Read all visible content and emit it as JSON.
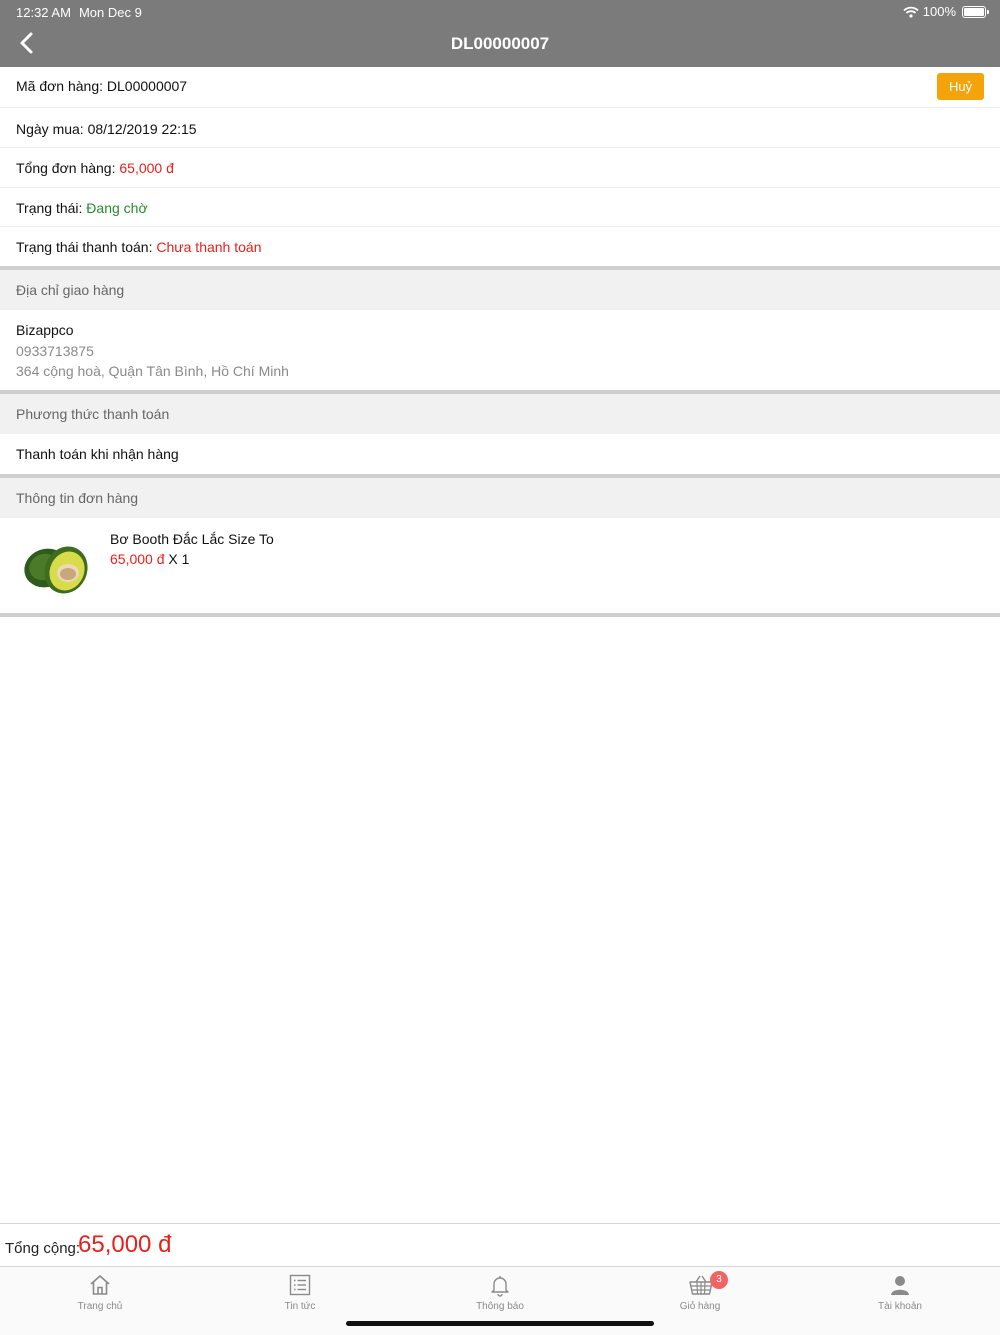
{
  "status": {
    "time": "12:32 AM",
    "date": "Mon Dec 9",
    "battery": "100%"
  },
  "nav": {
    "title": "DL00000007",
    "back_icon": "chevron-left-icon"
  },
  "order": {
    "code_label": "Mã đơn hàng:",
    "code_value": "DL00000007",
    "cancel_label": "Huỷ",
    "date_label": "Ngày mua:",
    "date_value": "08/12/2019 22:15",
    "total_label": "Tổng đơn hàng:",
    "total_value": "65,000 đ",
    "status_label": "Trạng thái:",
    "status_value": "Đang chờ",
    "payment_status_label": "Trạng thái thanh toán:",
    "payment_status_value": "Chưa thanh toán"
  },
  "shipping": {
    "heading": "Địa chỉ giao hàng",
    "name": "Bizappco",
    "phone": "0933713875",
    "address": "364 cộng hoà, Quận Tân Bình, Hồ Chí Minh"
  },
  "payment_method": {
    "heading": "Phương thức thanh toán",
    "value": "Thanh toán khi nhận hàng"
  },
  "order_info": {
    "heading": "Thông tin đơn hàng",
    "items": [
      {
        "name": "Bơ Booth Đắc Lắc Size To",
        "price": "65,000 đ",
        "qty": "X 1"
      }
    ]
  },
  "summary": {
    "total_label": "Tổng cộng:",
    "total_value": "65,000 đ"
  },
  "tabs": [
    {
      "label": "Trang chủ",
      "icon": "home-icon"
    },
    {
      "label": "Tin tức",
      "icon": "news-list-icon"
    },
    {
      "label": "Thông báo",
      "icon": "bell-icon"
    },
    {
      "label": "Giỏ hàng",
      "icon": "basket-icon",
      "badge": "3"
    },
    {
      "label": "Tài khoản",
      "icon": "user-icon"
    }
  ],
  "colors": {
    "nav_bg": "#7b7b7b",
    "price_red": "#e8211d",
    "status_green": "#2a8a2f",
    "cancel_orange": "#f5a30b",
    "badge": "#f06464"
  }
}
